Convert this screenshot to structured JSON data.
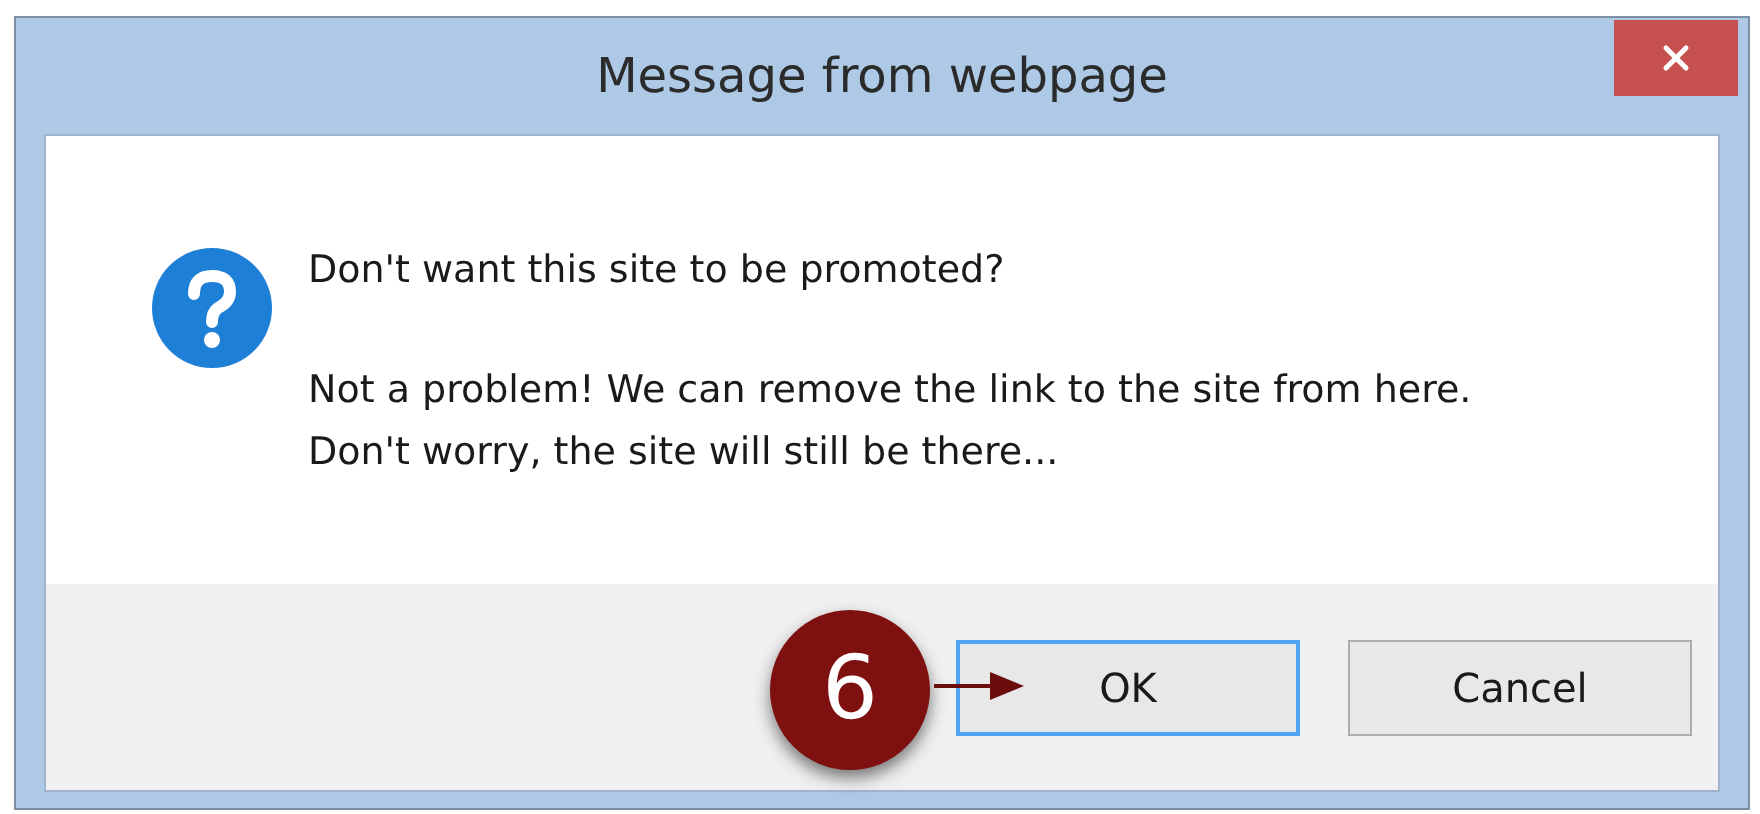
{
  "window": {
    "title": "Message from webpage"
  },
  "message": {
    "heading": "Don't want this site to be promoted?",
    "lines": [
      "Not a problem! We can remove the link to the site from here.",
      "Don't worry, the site will still be there..."
    ]
  },
  "buttons": [
    {
      "label": "OK",
      "focused": true
    },
    {
      "label": "Cancel",
      "focused": false
    }
  ],
  "callout": {
    "number": "6"
  }
}
